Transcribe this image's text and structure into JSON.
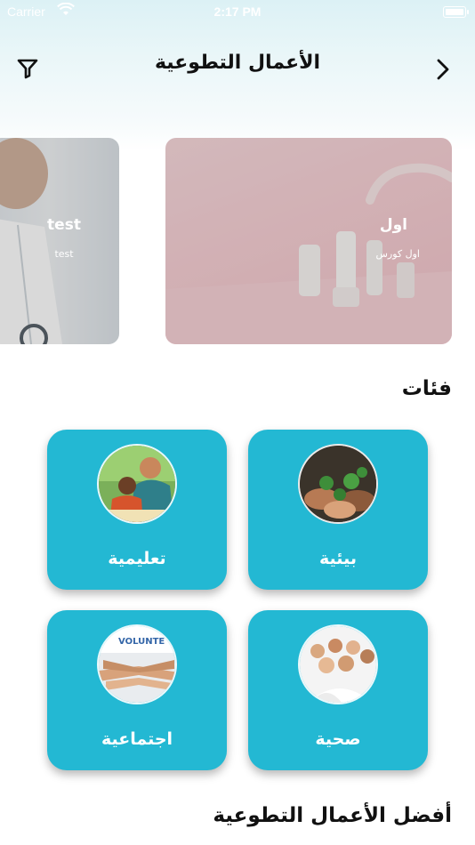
{
  "status_bar": {
    "carrier": "Carrier",
    "time": "2:17 PM"
  },
  "nav": {
    "title": "الأعمال التطوعية",
    "filter_icon": "filter-icon",
    "forward_icon": "chevron-right-icon"
  },
  "carousel": [
    {
      "title": "اول",
      "subtitle": "اول كورس"
    },
    {
      "title": "test",
      "subtitle": "test"
    }
  ],
  "categories": {
    "heading": "فئات",
    "items": [
      {
        "label": "بيئية"
      },
      {
        "label": "تعليمية"
      },
      {
        "label": "صحية"
      },
      {
        "label": "اجتماعية"
      }
    ]
  },
  "top_works": {
    "heading": "أفضل الأعمال التطوعية"
  },
  "colors": {
    "card": "#23b8d3",
    "header_tint": "#dcf1f5"
  }
}
